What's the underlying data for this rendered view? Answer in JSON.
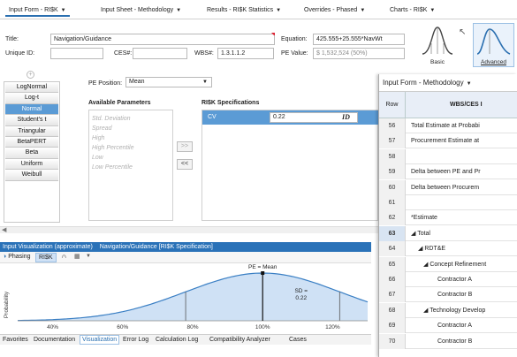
{
  "tabs": [
    {
      "label": "Input Form - RI$K"
    },
    {
      "label": "Input Sheet - Methodology"
    },
    {
      "label": "Results - RI$K Statistics"
    },
    {
      "label": "Overrides - Phased"
    },
    {
      "label": "Charts - RI$K"
    }
  ],
  "form": {
    "title_label": "Title:",
    "title_value": "Navigation/Guidance",
    "unique_id_label": "Unique ID:",
    "unique_id_value": "",
    "ces_label": "CES#:",
    "ces_value": "",
    "wbs_label": "WBS#:",
    "wbs_value": "1.3.1.1.2",
    "equation_label": "Equation:",
    "equation_value": "425.555+25.555*NavWt",
    "pe_value_label": "PE Value:",
    "pe_value_value": "$ 1,532,524 (50%)"
  },
  "modes": {
    "basic": "Basic",
    "advanced": "Advanced"
  },
  "distributions": {
    "items": [
      "LogNormal",
      "Log-t",
      "Normal",
      "Student's t",
      "Triangular",
      "BetaPERT",
      "Beta",
      "Uniform",
      "Weibull"
    ],
    "selected": "Normal"
  },
  "pe_position": {
    "label": "PE Position:",
    "value": "Mean"
  },
  "parameters": {
    "header": "Available Parameters",
    "items": [
      "Std. Deviation",
      "Spread",
      "High",
      "High Percentile",
      "Low",
      "Low Percentile"
    ],
    "add_btn": ">>",
    "remove_btn": "<<"
  },
  "spec": {
    "header": "RI$K Specifications",
    "row_label": "CV",
    "row_value": "0.22",
    "row_badge": "ID"
  },
  "viz": {
    "bar_label": "Input Visualization (approximate)",
    "bar_context": "Navigation/Guidance [RI$K Specification]",
    "phasing_label": "Phasing",
    "risk_label": "RI$K"
  },
  "chart_data": {
    "type": "area",
    "ylabel": "Probability",
    "x_ticks": [
      "40%",
      "60%",
      "80%",
      "100%",
      "120%"
    ],
    "x_tick_values": [
      40,
      60,
      80,
      100,
      120
    ],
    "xlim": [
      30,
      130
    ],
    "mean": 100,
    "sd": 0.22,
    "annotations": {
      "pe": "PE = Mean",
      "sd_line1": "SD =",
      "sd_line2": "0.22"
    },
    "colors": {
      "fill": "#cfe1f5",
      "line": "#3a7fc4"
    }
  },
  "bottom_tabs": {
    "items": [
      "Favorites",
      "Documentation",
      "Visualization",
      "Error Log",
      "Calculation Log",
      "Compatibility Analyzer",
      "Cases"
    ],
    "active": "Visualization"
  },
  "methodology": {
    "title": "Input Form - Methodology",
    "row_header": "Row",
    "col_header": "WBS/CES I",
    "rows": [
      {
        "num": "56",
        "text": "Total Estimate at Probabi"
      },
      {
        "num": "57",
        "text": "Procurement Estimate at"
      },
      {
        "num": "58",
        "text": ""
      },
      {
        "num": "59",
        "text": "Delta between PE and Pr"
      },
      {
        "num": "60",
        "text": "Delta between Procurem"
      },
      {
        "num": "61",
        "text": ""
      },
      {
        "num": "62",
        "text": "*Estimate"
      },
      {
        "num": "63",
        "text": "◢ Total"
      },
      {
        "num": "64",
        "text": "◢ RDT&E"
      },
      {
        "num": "65",
        "text": "◢ Concept Refinement"
      },
      {
        "num": "66",
        "text": "Contractor A"
      },
      {
        "num": "67",
        "text": "Contractor B"
      },
      {
        "num": "68",
        "text": "◢ Technology Develop"
      },
      {
        "num": "69",
        "text": "Contractor A"
      },
      {
        "num": "70",
        "text": "Contractor B"
      }
    ],
    "selected_row": "63"
  }
}
